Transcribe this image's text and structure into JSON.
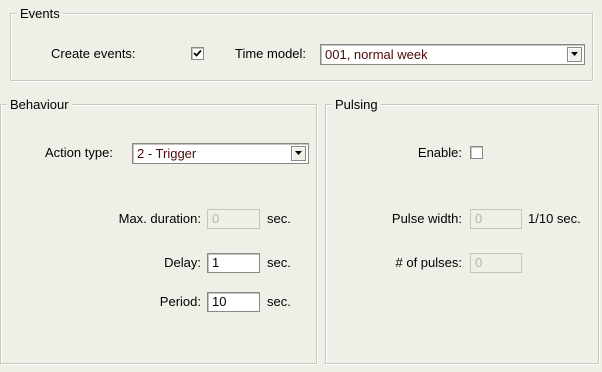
{
  "events": {
    "title": "Events",
    "create_events_label": "Create events:",
    "create_events_checked": true,
    "time_model_label": "Time model:",
    "time_model_value": "001, normal week"
  },
  "behaviour": {
    "title": "Behaviour",
    "action_type_label": "Action type:",
    "action_type_value": "2 - Trigger",
    "max_duration_label": "Max. duration:",
    "max_duration_value": "0",
    "max_duration_unit": "sec.",
    "delay_label": "Delay:",
    "delay_value": "1",
    "delay_unit": "sec.",
    "period_label": "Period:",
    "period_value": "10",
    "period_unit": "sec."
  },
  "pulsing": {
    "title": "Pulsing",
    "enable_label": "Enable:",
    "enable_checked": false,
    "pulse_width_label": "Pulse width:",
    "pulse_width_value": "0",
    "pulse_width_unit": "1/10 sec.",
    "pulses_label": "# of pulses:",
    "pulses_value": "0"
  },
  "icons": {
    "dropdown": "chevron-down-icon",
    "checkmark": "checkmark-icon"
  }
}
